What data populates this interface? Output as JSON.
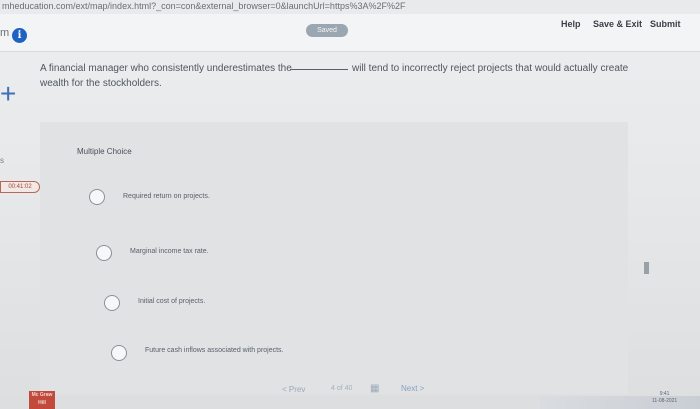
{
  "browser": {
    "url": "mheducation.com/ext/map/index.html?_con=con&external_browser=0&launchUrl=https%3A%2F%2F"
  },
  "header": {
    "left_label": "m",
    "info_icon": "info-icon",
    "saved": "Saved",
    "help": "Help",
    "save_exit": "Save & Exit",
    "submit": "Submit"
  },
  "question": {
    "line1_part1": "A financial manager who consistently underestimates the",
    "line1_part2": "will tend to incorrectly reject projects that would actually create",
    "line2": "wealth for the stockholders."
  },
  "side": {
    "letter": "s",
    "timer": "00:41:02"
  },
  "multiple_choice": {
    "title": "Multiple Choice",
    "options": [
      "Required return on projects.",
      "Marginal income tax rate.",
      "Initial cost of projects.",
      "Future cash inflows associated with projects."
    ]
  },
  "footer": {
    "prev": "< Prev",
    "page": "4 of 40",
    "next": "Next >",
    "logo": "Mc Graw Hill",
    "clock_time": "9:41",
    "clock_date": "11-08-2021"
  },
  "colors": {
    "accent": "#1e63c4",
    "timer_border": "#b46a5a",
    "logo": "#c24a3c"
  }
}
